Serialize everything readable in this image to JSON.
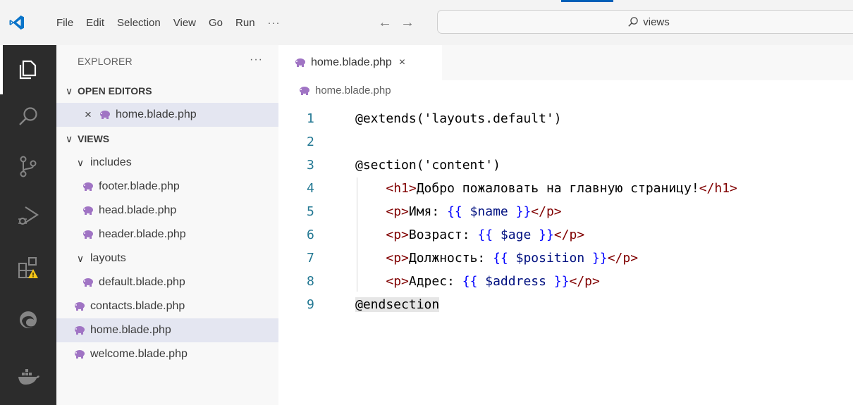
{
  "window": {
    "menu": [
      "File",
      "Edit",
      "Selection",
      "View",
      "Go",
      "Run"
    ],
    "more": "···",
    "back": "←",
    "forward": "→",
    "search": "views"
  },
  "sidebar": {
    "title": "EXPLORER",
    "more": "···",
    "open_editors_label": "OPEN EDITORS",
    "open_editor_item": "home.blade.php",
    "folder_label": "VIEWS",
    "tree": [
      {
        "label": "includes",
        "kind": "folder",
        "depth": 1
      },
      {
        "label": "footer.blade.php",
        "kind": "file",
        "depth": 2
      },
      {
        "label": "head.blade.php",
        "kind": "file",
        "depth": 2
      },
      {
        "label": "header.blade.php",
        "kind": "file",
        "depth": 2
      },
      {
        "label": "layouts",
        "kind": "folder",
        "depth": 1
      },
      {
        "label": "default.blade.php",
        "kind": "file",
        "depth": 2
      },
      {
        "label": "contacts.blade.php",
        "kind": "file",
        "depth": 1
      },
      {
        "label": "home.blade.php",
        "kind": "file",
        "depth": 1,
        "selected": true
      },
      {
        "label": "welcome.blade.php",
        "kind": "file",
        "depth": 1
      }
    ]
  },
  "editor": {
    "tab_label": "home.blade.php",
    "tab_close": "×",
    "breadcrumb": "home.blade.php",
    "lines": [
      {
        "n": "1",
        "parts": [
          {
            "t": "@extends('layouts.default')",
            "c": ""
          }
        ]
      },
      {
        "n": "2",
        "parts": []
      },
      {
        "n": "3",
        "parts": [
          {
            "t": "@section('content')",
            "c": ""
          }
        ]
      },
      {
        "n": "4",
        "parts": [
          {
            "t": "    ",
            "c": ""
          },
          {
            "t": "<h1>",
            "c": "tag"
          },
          {
            "t": "Добро пожаловать на главную страницу!",
            "c": ""
          },
          {
            "t": "</h1>",
            "c": "tag"
          }
        ]
      },
      {
        "n": "5",
        "parts": [
          {
            "t": "    ",
            "c": ""
          },
          {
            "t": "<p>",
            "c": "tag"
          },
          {
            "t": "Имя: ",
            "c": ""
          },
          {
            "t": "{{",
            "c": "brk"
          },
          {
            "t": " $name ",
            "c": "var"
          },
          {
            "t": "}}",
            "c": "brk"
          },
          {
            "t": "</p>",
            "c": "tag"
          }
        ]
      },
      {
        "n": "6",
        "parts": [
          {
            "t": "    ",
            "c": ""
          },
          {
            "t": "<p>",
            "c": "tag"
          },
          {
            "t": "Возраст: ",
            "c": ""
          },
          {
            "t": "{{",
            "c": "brk"
          },
          {
            "t": " $age ",
            "c": "var"
          },
          {
            "t": "}}",
            "c": "brk"
          },
          {
            "t": "</p>",
            "c": "tag"
          }
        ]
      },
      {
        "n": "7",
        "parts": [
          {
            "t": "    ",
            "c": ""
          },
          {
            "t": "<p>",
            "c": "tag"
          },
          {
            "t": "Должность: ",
            "c": ""
          },
          {
            "t": "{{",
            "c": "brk"
          },
          {
            "t": " $position ",
            "c": "var"
          },
          {
            "t": "}}",
            "c": "brk"
          },
          {
            "t": "</p>",
            "c": "tag"
          }
        ]
      },
      {
        "n": "8",
        "parts": [
          {
            "t": "    ",
            "c": ""
          },
          {
            "t": "<p>",
            "c": "tag"
          },
          {
            "t": "Адрес: ",
            "c": ""
          },
          {
            "t": "{{",
            "c": "brk"
          },
          {
            "t": " $address ",
            "c": "var"
          },
          {
            "t": "}}",
            "c": "brk"
          },
          {
            "t": "</p>",
            "c": "tag"
          }
        ]
      },
      {
        "n": "9",
        "parts": [
          {
            "t": "@endsection",
            "c": "cur"
          }
        ]
      }
    ]
  },
  "icons": {
    "activity_bar": [
      "explorer-icon",
      "search-icon",
      "source-control-icon",
      "run-debug-icon",
      "extensions-icon",
      "edge-icon",
      "docker-icon"
    ],
    "file": "php-elephant-icon"
  },
  "colors": {
    "accent": "#005fb8",
    "activity_bar": "#2c2c2c",
    "sidebar": "#f8f8f8",
    "selection": "#e4e6f1",
    "line_number": "#237893",
    "tag": "#800000",
    "bracket": "#0000ff",
    "variable": "#001080",
    "php_icon": "#a074c4",
    "warning": "#f5c518"
  }
}
